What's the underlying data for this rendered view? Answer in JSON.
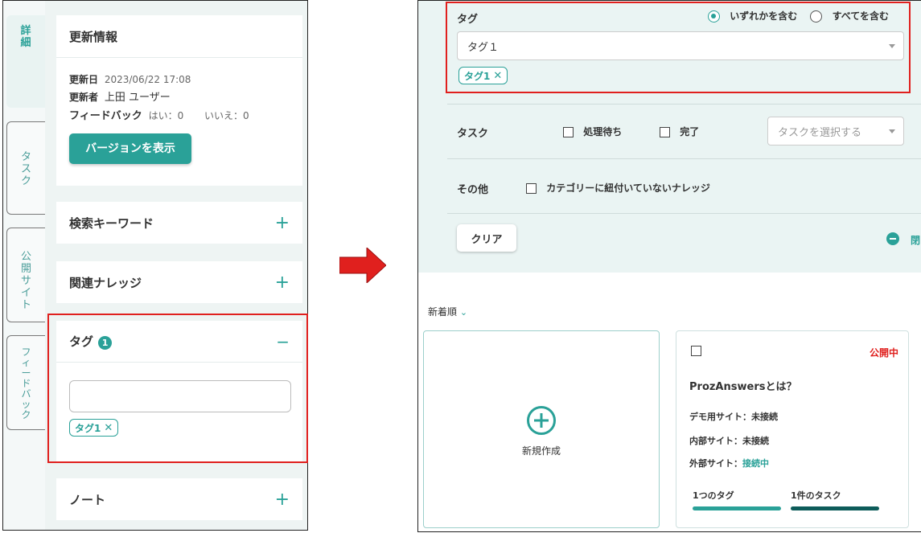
{
  "left": {
    "tabs": [
      {
        "label": "詳細",
        "active": true
      },
      {
        "label": "タスク",
        "active": false
      },
      {
        "label": "公開サイト",
        "active": false
      },
      {
        "label": "フィードバック",
        "active": false
      }
    ],
    "update": {
      "title": "更新情報",
      "date_label": "更新日",
      "date_value": "2023/06/22 17:08",
      "user_label": "更新者",
      "user_value": "上田 ユーザー",
      "feedback_label": "フィードバック",
      "feedback_yes": "はい：0",
      "feedback_no": "いいえ：0",
      "version_button": "バージョンを表示"
    },
    "keyword_section": "検索キーワード",
    "related_section": "関連ナレッジ",
    "tag_section": {
      "title": "タグ",
      "count": "1",
      "input_value": "",
      "chip": "タグ1",
      "collapse_symbol": "−"
    },
    "note_section": "ノート",
    "expand_symbol": "+"
  },
  "right": {
    "tag_filter": {
      "label": "タグ",
      "radio_any": "いずれかを含む",
      "radio_all": "すべてを含む",
      "select_value": "タグ１",
      "chip": "タグ1"
    },
    "task_filter": {
      "label": "タスク",
      "option_pending": "処理待ち",
      "option_done": "完了",
      "select_placeholder": "タスクを選択する"
    },
    "other_filter": {
      "label": "その他",
      "option": "カテゴリーに紐付いていないナレッジ"
    },
    "clear_button": "クリア",
    "collapse_label": "閉",
    "sort_label": "新着順",
    "new_card_label": "新規作成",
    "knowledge": {
      "status": "公開中",
      "title": "ProzAnswersとは？",
      "site_demo_label": "デモ用サイト：",
      "site_demo_value": "未接続",
      "site_internal_label": "内部サイト：",
      "site_internal_value": "未接続",
      "site_external_label": "外部サイト：",
      "site_external_value": "接続中",
      "tag_count": "1つのタグ",
      "task_count": "1件のタスク"
    }
  },
  "colors": {
    "accent": "#2aa198",
    "highlight": "#e0201e",
    "status_public": "#e0201e",
    "dark_bar": "#0d5c5a"
  }
}
